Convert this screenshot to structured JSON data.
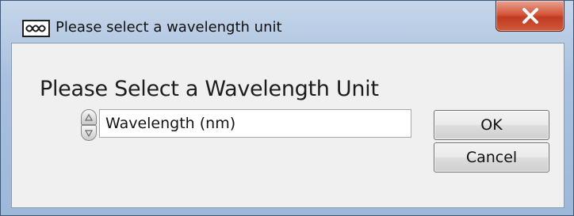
{
  "window": {
    "title": "Please select a wavelength unit",
    "icon": "labview-vi-icon",
    "close_icon": "close-icon",
    "colors": {
      "title_bar": "#a9c1df",
      "close_button": "#c9462b",
      "client": "#f0f0f0"
    }
  },
  "content": {
    "heading": "Please Select a Wavelength Unit",
    "unit_selector": {
      "value": "Wavelength (nm)",
      "spin_icon": "up-down-spinner-icon"
    }
  },
  "buttons": {
    "ok_label": "OK",
    "cancel_label": "Cancel"
  }
}
